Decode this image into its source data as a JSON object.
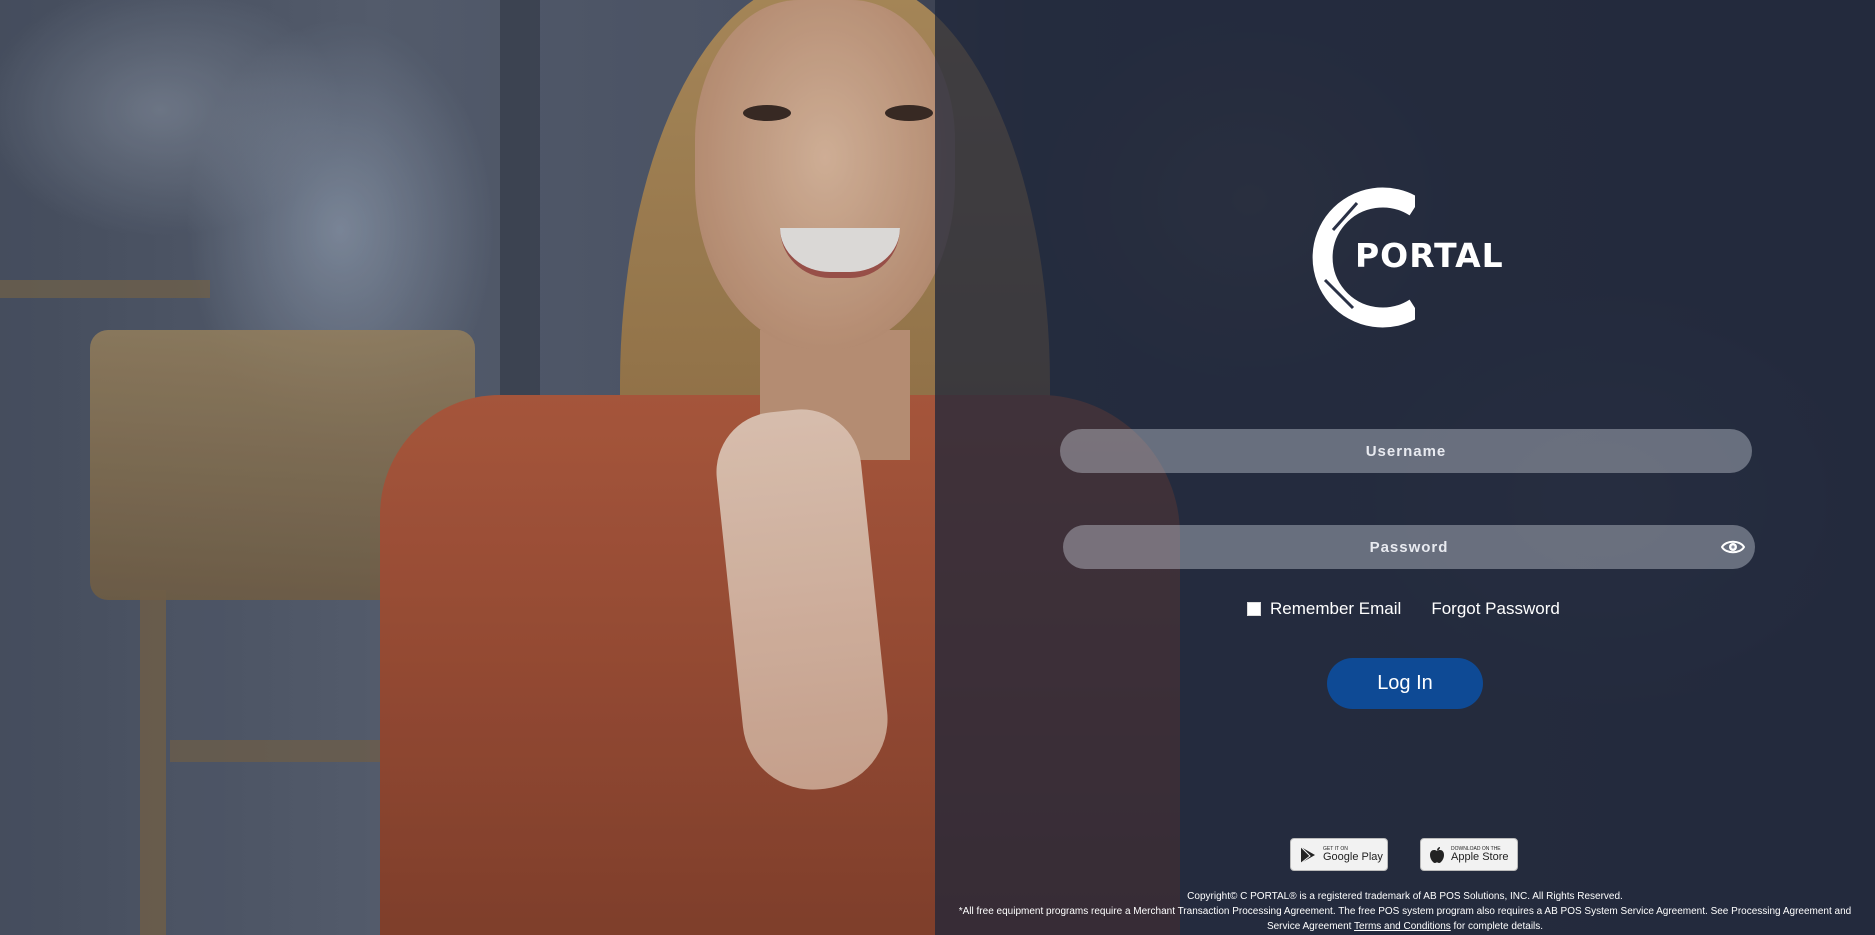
{
  "brand": {
    "logo_text": "PORTAL"
  },
  "login": {
    "username_placeholder": "Username",
    "password_placeholder": "Password",
    "remember_label": "Remember Email",
    "forgot_label": "Forgot Password",
    "login_label": "Log In"
  },
  "stores": {
    "google_small": "GET IT ON",
    "google_big": "Google Play",
    "apple_small": "DOWNLOAD ON THE",
    "apple_big": "Apple Store"
  },
  "footer": {
    "copyright": "Copyright© C PORTAL® is a registered trademark of AB POS Solutions, INC. All Rights Reserved.",
    "disclaimer": "*All free equipment programs require a Merchant Transaction Processing Agreement. The free POS system program also requires a AB POS System Service Agreement. See Processing Agreement and Service Agreement",
    "terms_link": "Terms and Conditions",
    "terms_suffix": "for complete details."
  },
  "colors": {
    "accent": "#0e4a95",
    "overlay": "#1f263a"
  }
}
